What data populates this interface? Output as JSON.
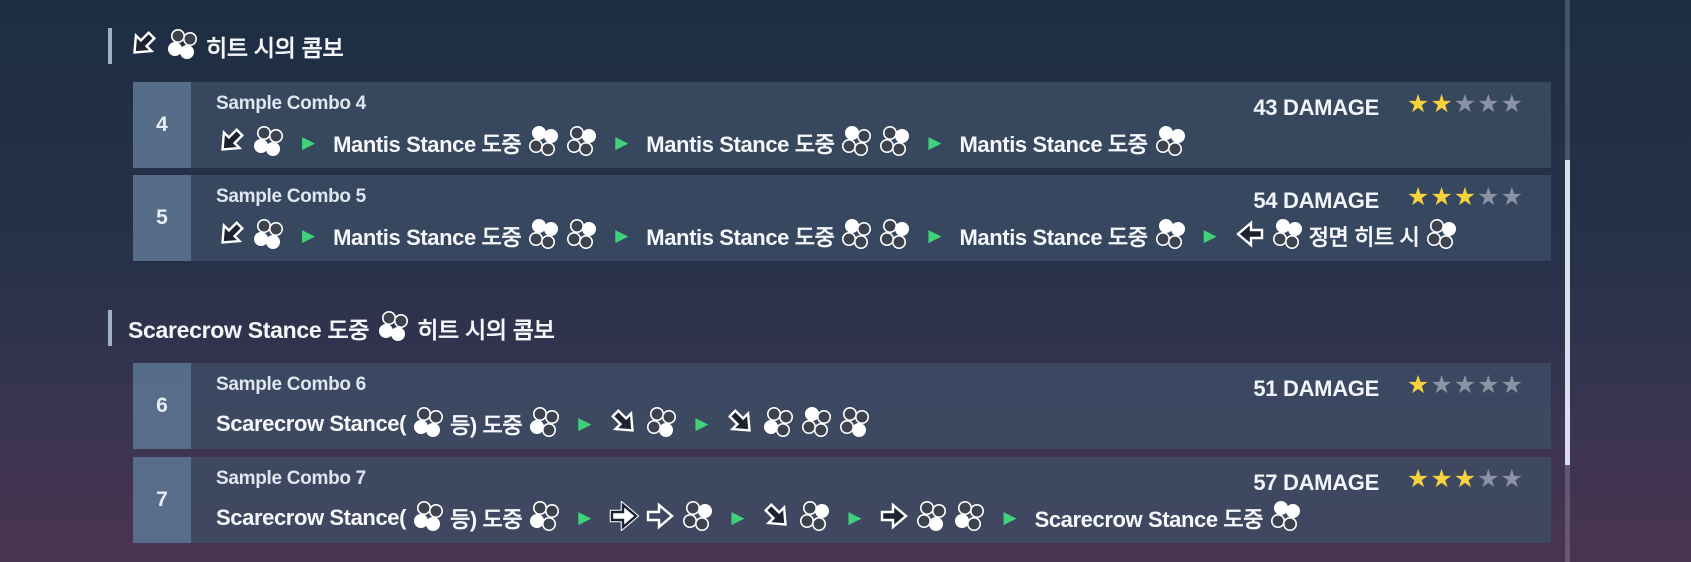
{
  "sections": [
    {
      "heading_icons": [
        "down-left-arrow-icon",
        "button-34-icon"
      ],
      "heading_text": "히트 시의 콤보"
    },
    {
      "heading_text_a": "Scarecrow Stance 도중",
      "heading_icons": [
        "button-34-icon"
      ],
      "heading_text_b": "히트 시의 콤보"
    }
  ],
  "combos": [
    {
      "number": "4",
      "title": "Sample Combo 4",
      "damage": "43 DAMAGE",
      "rating": 2,
      "max_rating": 5,
      "mantis": "Mantis Stance 도중"
    },
    {
      "number": "5",
      "title": "Sample Combo 5",
      "damage": "54 DAMAGE",
      "rating": 3,
      "max_rating": 5,
      "mantis": "Mantis Stance 도중",
      "front_hit": "정면 히트 시"
    },
    {
      "number": "6",
      "title": "Sample Combo 6",
      "damage": "51 DAMAGE",
      "rating": 1,
      "max_rating": 5,
      "scarecrow_open": "Scarecrow Stance(",
      "scarecrow_close": "등) 도중"
    },
    {
      "number": "7",
      "title": "Sample Combo 7",
      "damage": "57 DAMAGE",
      "rating": 3,
      "max_rating": 5,
      "scarecrow_open": "Scarecrow Stance(",
      "scarecrow_close": "등) 도중",
      "scarecrow_end": "Scarecrow Stance 도중"
    }
  ],
  "colors": {
    "star_on": "#f6d23b",
    "star_off": "#8a92a3",
    "separator": "#3fd27a"
  }
}
